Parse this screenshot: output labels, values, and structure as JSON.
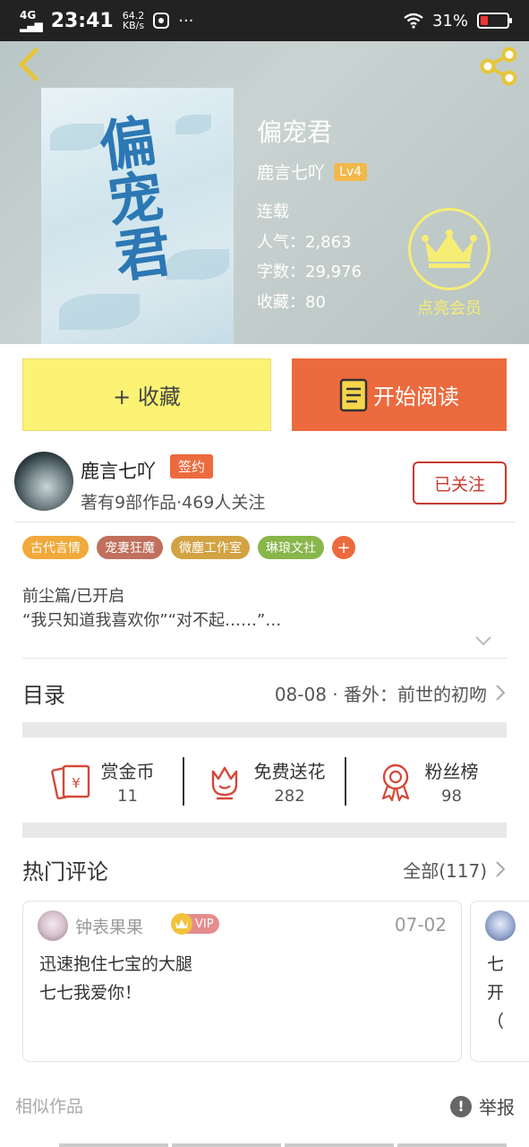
{
  "status_bar": {
    "network": "4G",
    "time": "23:41",
    "speed_value": "64.2",
    "speed_unit": "KB/s",
    "more": "···",
    "battery": "31%",
    "battery_level": 0.31
  },
  "book": {
    "title": "偏宠君",
    "cover_title": "偏宠君",
    "author": "鹿言七吖",
    "author_level": "Lv4",
    "status": "连载",
    "popularity": "人气：2,863",
    "word_count": "字数：29,976",
    "collections": "收藏：80",
    "membership_label": "点亮会员"
  },
  "actions": {
    "collect_label": "+ 收藏",
    "read_label": "开始阅读"
  },
  "author": {
    "name": "鹿言七吖",
    "badge": "签约",
    "summary": "著有9部作品·469人关注",
    "follow_label": "已关注"
  },
  "tags": [
    {
      "label": "古代言情",
      "color": "#f0a93a"
    },
    {
      "label": "宠妻狂魔",
      "color": "#c0705c"
    },
    {
      "label": "微塵工作室",
      "color": "#d3a243"
    },
    {
      "label": "琳琅文社",
      "color": "#88b64a"
    }
  ],
  "tag_add": "+",
  "description": {
    "line1": "前尘篇/已开启",
    "line2": "“我只知道我喜欢你”“对不起……”…"
  },
  "toc": {
    "title": "目录",
    "latest": "08-08 · 番外：前世的初吻"
  },
  "stats": [
    {
      "label": "赏金币",
      "value": "11",
      "icon": "red-envelope-icon"
    },
    {
      "label": "免费送花",
      "value": "282",
      "icon": "flower-icon"
    },
    {
      "label": "粉丝榜",
      "value": "98",
      "icon": "medal-icon"
    }
  ],
  "comments_section": {
    "title": "热门评论",
    "all_label": "全部(117)"
  },
  "comments": [
    {
      "user": "钟表果果",
      "badge": "VIP",
      "date": "07-02",
      "line1": "迅速抱住七宝的大腿",
      "line2": "七七我爱你！"
    },
    {
      "line1": "七",
      "line2": "开",
      "line3": "（"
    }
  ],
  "footer": {
    "similar": "相似作品",
    "report": "举报"
  },
  "colors": {
    "accent": "#ec6a3e",
    "collect_bg": "#fcf374",
    "follow_border": "#c83a2e",
    "crown": "#f6ed74"
  }
}
